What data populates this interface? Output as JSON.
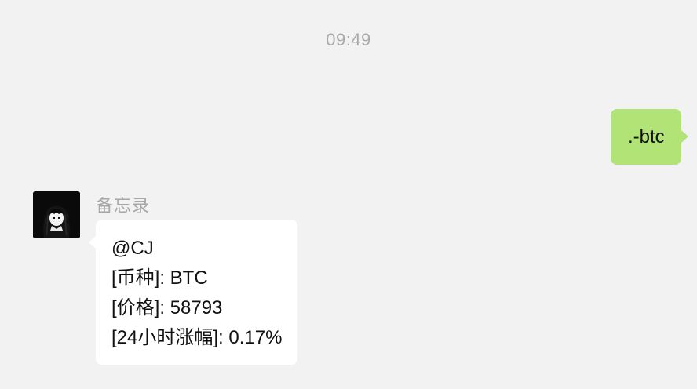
{
  "timestamp": "09:49",
  "outgoing_message": {
    "text": ".-btc",
    "bubble_color": "#b1e376"
  },
  "incoming_message": {
    "sender_name": "备忘录",
    "avatar_icon": "anime-girl-avatar-icon",
    "lines": [
      "@CJ",
      "[币种]: BTC",
      "[价格]: 58793",
      "[24小时涨幅]: 0.17%"
    ],
    "bubble_color": "#ffffff"
  },
  "background_color": "#f2f2f2"
}
